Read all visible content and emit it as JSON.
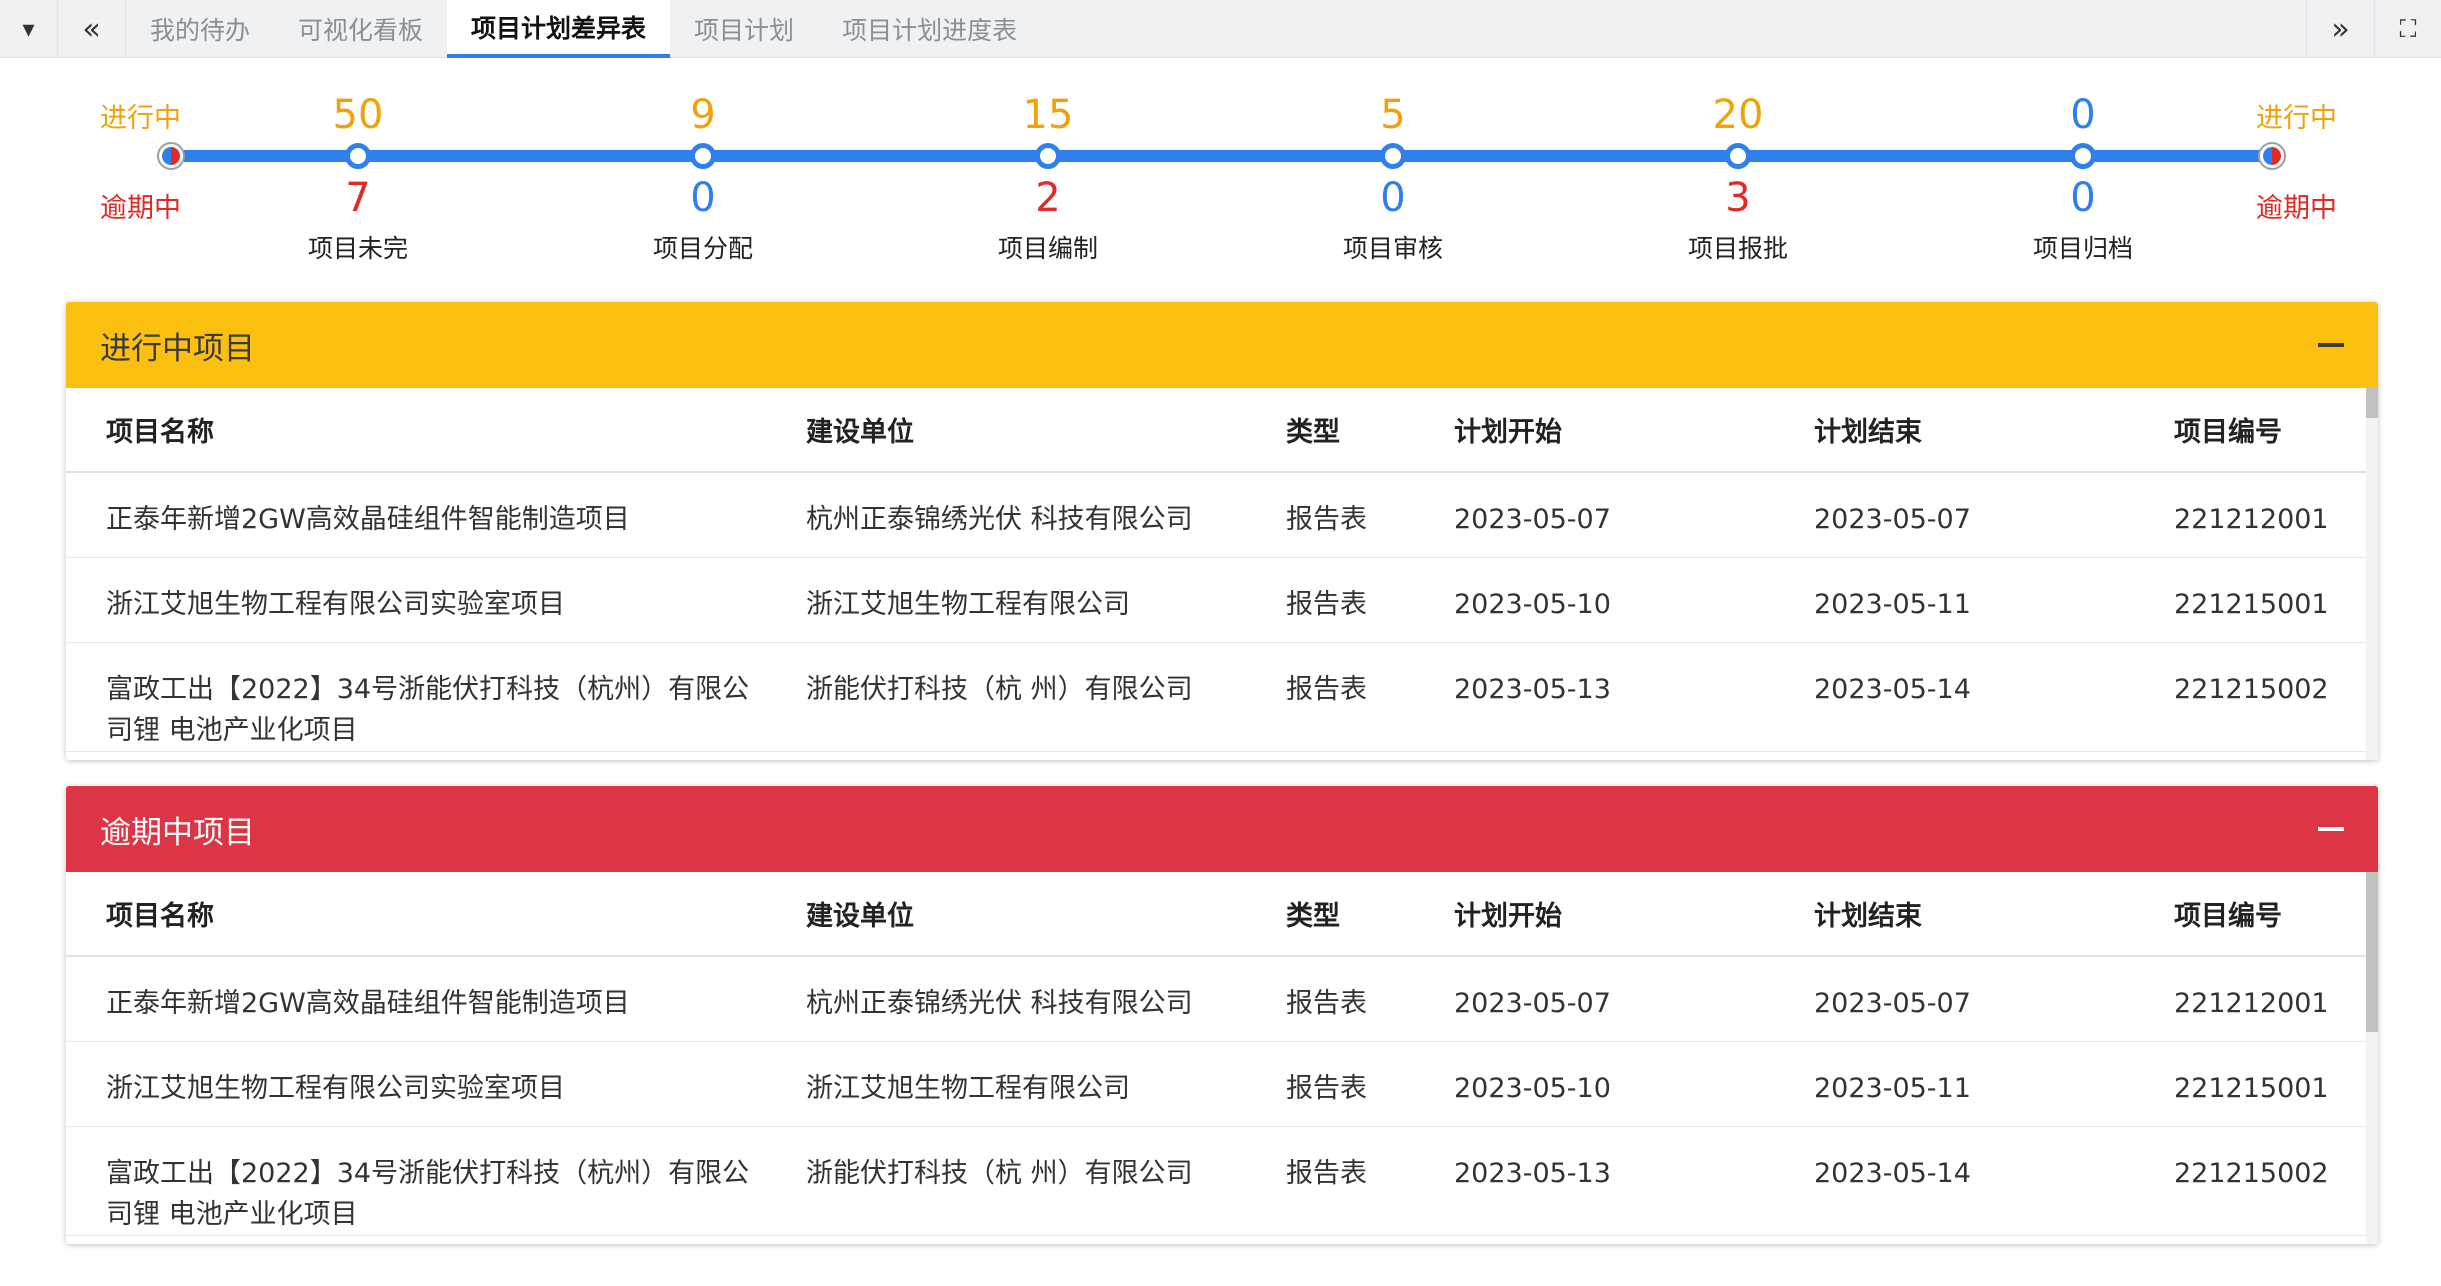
{
  "tabbar": {
    "tabs": [
      {
        "label": "我的待办"
      },
      {
        "label": "可视化看板"
      },
      {
        "label": "项目计划差异表"
      },
      {
        "label": "项目计划"
      },
      {
        "label": "项目计划进度表"
      }
    ],
    "active_tab": "项目计划差异表",
    "left_dropdown_icon": "▾",
    "scroll_left_icon": "«",
    "scroll_right_icon": "»",
    "fullscreen_icon": "⛶"
  },
  "timeline": {
    "left_top_label": "进行中",
    "left_bottom_label": "逾期中",
    "right_top_label": "进行中",
    "right_bottom_label": "逾期中",
    "stages": [
      {
        "name": "项目未完",
        "in_progress": "50",
        "overdue": "7"
      },
      {
        "name": "项目分配",
        "in_progress": "9",
        "overdue": "0"
      },
      {
        "name": "项目编制",
        "in_progress": "15",
        "overdue": "2"
      },
      {
        "name": "项目审核",
        "in_progress": "5",
        "overdue": "0"
      },
      {
        "name": "项目报批",
        "in_progress": "20",
        "overdue": "3"
      },
      {
        "name": "项目归档",
        "in_progress": "0",
        "overdue": "0"
      }
    ],
    "colors": {
      "line": "#2f80ed",
      "in_progress": "#f0a20b",
      "overdue": "#e02a26",
      "zero": "#2f80ed"
    }
  },
  "in_progress_panel": {
    "title": "进行中项目",
    "color": "#fbbf0f",
    "columns": [
      "项目名称",
      "建设单位",
      "类型",
      "计划开始",
      "计划结束",
      "项目编号"
    ],
    "rows": [
      [
        "正泰年新增2GW高效晶硅组件智能制造项目",
        "杭州正泰锦绣光伏 科技有限公司",
        "报告表",
        "2023-05-07",
        "2023-05-07",
        "221212001"
      ],
      [
        "浙江艾旭生物工程有限公司实验室项目",
        "浙江艾旭生物工程有限公司",
        "报告表",
        "2023-05-10",
        "2023-05-11",
        "221215001"
      ],
      [
        "富政工出【2022】34号浙能伏打科技（杭州）有限公司锂 电池产业化项目",
        "浙能伏打科技（杭 州）有限公司",
        "报告表",
        "2023-05-13",
        "2023-05-14",
        "221215002"
      ]
    ]
  },
  "overdue_panel": {
    "title": "逾期中项目",
    "color": "#dc3545",
    "columns": [
      "项目名称",
      "建设单位",
      "类型",
      "计划开始",
      "计划结束",
      "项目编号"
    ],
    "rows": [
      [
        "正泰年新增2GW高效晶硅组件智能制造项目",
        "杭州正泰锦绣光伏 科技有限公司",
        "报告表",
        "2023-05-07",
        "2023-05-07",
        "221212001"
      ],
      [
        "浙江艾旭生物工程有限公司实验室项目",
        "浙江艾旭生物工程有限公司",
        "报告表",
        "2023-05-10",
        "2023-05-11",
        "221215001"
      ],
      [
        "富政工出【2022】34号浙能伏打科技（杭州）有限公司锂 电池产业化项目",
        "浙能伏打科技（杭 州）有限公司",
        "报告表",
        "2023-05-13",
        "2023-05-14",
        "221215002"
      ]
    ]
  }
}
